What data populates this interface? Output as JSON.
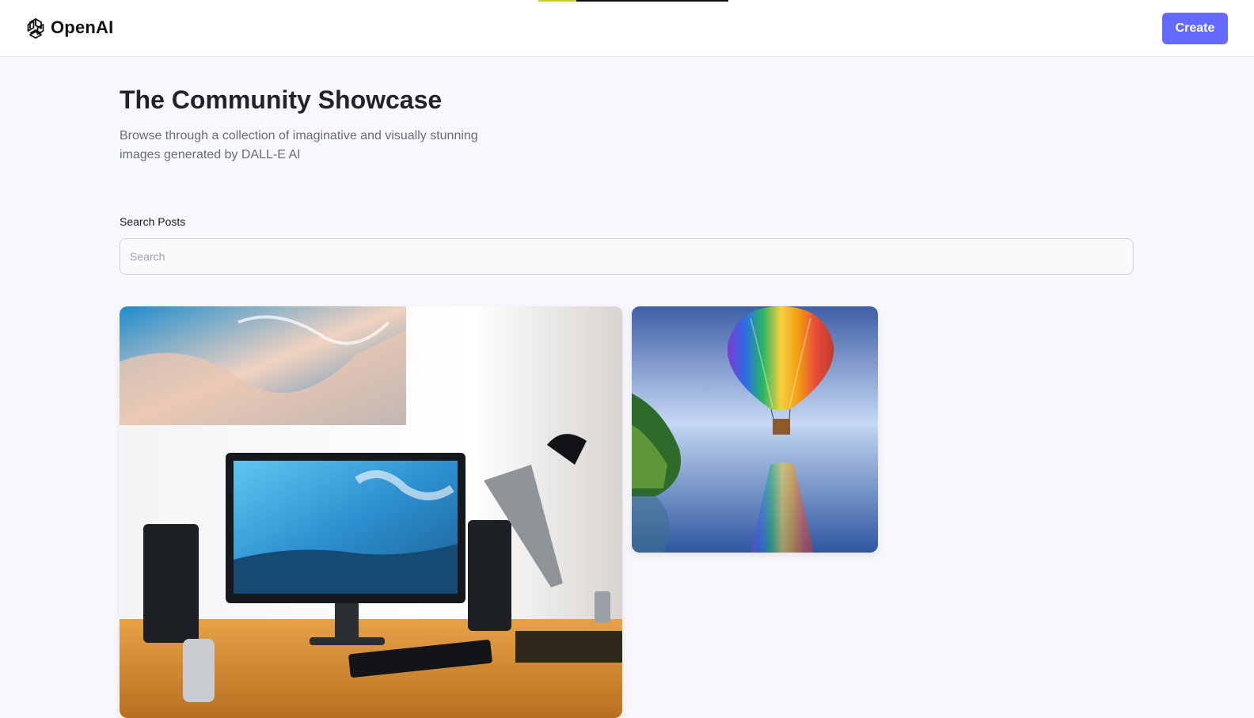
{
  "header": {
    "logo_text": "OpenAI",
    "create_label": "Create",
    "accent_color": "#6469ff"
  },
  "hero": {
    "title": "The Community Showcase",
    "subtitle": "Browse through a collection of imaginative and visually stunning images generated by DALL-E AI"
  },
  "search": {
    "label": "Search Posts",
    "placeholder": "Search",
    "value": ""
  },
  "gallery": {
    "items": [
      {
        "subject": "desk-setup"
      },
      {
        "subject": "rainbow-hot-air-balloon"
      }
    ]
  }
}
